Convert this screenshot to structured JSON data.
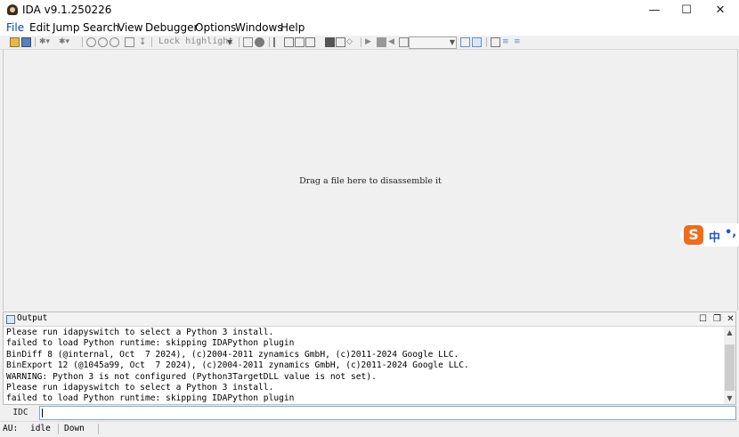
{
  "window": {
    "title": "IDA v9.1.250226",
    "minimize_glyph": "—",
    "maximize_glyph": "☐",
    "close_glyph": "✕"
  },
  "menu": [
    "File",
    "Edit",
    "Jump",
    "Search",
    "View",
    "Debugger",
    "Options",
    "Windows",
    "Help"
  ],
  "toolbar": {
    "lock_highlight_label": "Lock highlight",
    "icons": [
      "open-icon",
      "save-icon",
      "back-icon",
      "forward-icon",
      "graph-icon",
      "text-view-icon",
      "hex-view-icon",
      "struct-icon",
      "jump-icon",
      "lock-icon",
      "calc-icon",
      "help-icon",
      "code-icon",
      "data-icon",
      "string-icon",
      "array-icon",
      "undefine-icon",
      "rename-icon",
      "comment-icon",
      "run-icon",
      "pause-icon",
      "stop-icon",
      "step-icon",
      "trace-icon",
      "breakpoint-icon",
      "attach-icon",
      "detach-icon"
    ]
  },
  "workspace": {
    "hint": "Drag a file here to disassemble it"
  },
  "ime": {
    "logo": "S",
    "mode": "中",
    "punct": "•,"
  },
  "output": {
    "title": "Output",
    "lines": [
      "Please run idapyswitch to select a Python 3 install.",
      "failed to load Python runtime: skipping IDAPython plugin",
      "BinDiff 8 (@internal, Oct  7 2024), (c)2004-2011 zynamics GmbH, (c)2011-2024 Google LLC.",
      "BinExport 12 (@1045a99, Oct  7 2024), (c)2004-2011 zynamics GmbH, (c)2011-2024 Google LLC.",
      "WARNING: Python 3 is not configured (Python3TargetDLL value is not set).",
      "Please run idapyswitch to select a Python 3 install.",
      "failed to load Python runtime: skipping IDAPython plugin"
    ]
  },
  "command": {
    "language": "IDC",
    "value": ""
  },
  "status": {
    "au_label": "AU:",
    "au_state": "idle",
    "direction": "Down"
  },
  "colors": {
    "accent": "#0040c0",
    "ime_brand": "#f26a1b"
  }
}
